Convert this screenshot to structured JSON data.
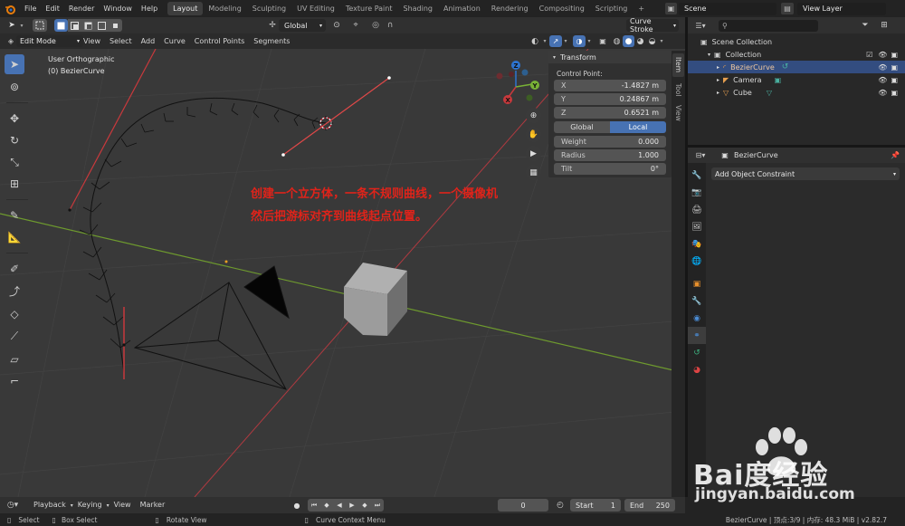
{
  "topbar": {
    "menus": [
      "File",
      "Edit",
      "Render",
      "Window",
      "Help"
    ],
    "workspaces": [
      "Layout",
      "Modeling",
      "Sculpting",
      "UV Editing",
      "Texture Paint",
      "Shading",
      "Animation",
      "Rendering",
      "Compositing",
      "Scripting"
    ],
    "active_workspace": "Layout",
    "add_tab": "+",
    "scene": "Scene",
    "view_layer": "View Layer"
  },
  "viewport_header": {
    "transform_orientation": "Global",
    "brush_dropdown": "Curve Stroke",
    "mode": "Edit Mode",
    "menus": [
      "View",
      "Select",
      "Add",
      "Curve",
      "Control Points",
      "Segments"
    ]
  },
  "viewport": {
    "view_name": "User Orthographic",
    "object_name": "(0) BezierCurve",
    "annotation_line1": "创建一个立方体，一条不规则曲线，一个摄像机",
    "annotation_line2": "然后把游标对齐到曲线起点位置。",
    "gizmo_axes": [
      "Z",
      "Y",
      "X"
    ]
  },
  "n_panel": {
    "header": "Transform",
    "section": "Control Point:",
    "fields": [
      {
        "label": "X",
        "value": "-1.4827 m"
      },
      {
        "label": "Y",
        "value": "0.24867 m"
      },
      {
        "label": "Z",
        "value": "0.6521 m"
      }
    ],
    "toggle": [
      "Global",
      "Local"
    ],
    "active_toggle": "Local",
    "weight": {
      "label": "Weight",
      "value": "0.000"
    },
    "radius": {
      "label": "Radius",
      "value": "1.000"
    },
    "tilt": {
      "label": "Tilt",
      "value": "0°"
    },
    "side_tabs": [
      "Item",
      "Tool",
      "View"
    ]
  },
  "outliner": {
    "root": "Scene Collection",
    "items": [
      {
        "label": "Collection",
        "indent": 1
      },
      {
        "label": "BezierCurve",
        "indent": 2,
        "selected": true
      },
      {
        "label": "Camera",
        "indent": 2
      },
      {
        "label": "Cube",
        "indent": 2
      }
    ]
  },
  "properties": {
    "object_name": "BezierCurve",
    "add_constraint": "Add Object Constraint"
  },
  "timeline": {
    "menus": [
      "Playback",
      "Keying",
      "View",
      "Marker"
    ],
    "current_frame": "0",
    "start_label": "Start",
    "start_value": "1",
    "end_label": "End",
    "end_value": "250"
  },
  "statusbar": {
    "hints": [
      "Select",
      "Box Select",
      "Rotate View",
      "Curve Context Menu"
    ],
    "info": "BezierCurve | 顶点:3/9 | 内存: 48.3 MiB | v2.82.7"
  },
  "watermark": {
    "brand": "Bai度经验",
    "url": "jingyan.baidu.com"
  },
  "colors": {
    "accent": "#4772b3",
    "annotation": "#e0231a",
    "x_axis": "#c8393c",
    "y_axis": "#79b236",
    "z_axis": "#2d74d0"
  }
}
